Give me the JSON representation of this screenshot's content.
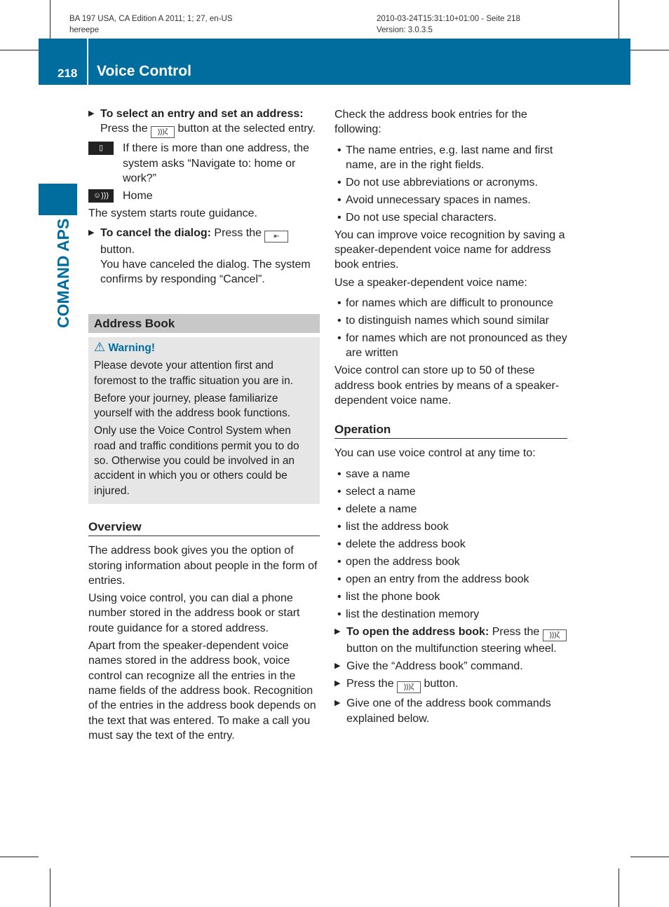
{
  "meta": {
    "left1": "BA 197 USA, CA Edition A 2011; 1; 27, en-US",
    "left2": "hereepe",
    "right1": "2010-03-24T15:31:10+01:00 - Seite 218",
    "right2": "Version: 3.0.3.5"
  },
  "header": {
    "page_number": "218",
    "title": "Voice Control",
    "side_tab": "COMAND APS",
    "accent": "#006d9f"
  },
  "left": {
    "step1_bold": "To select an entry and set an address:",
    "step1_a": "Press the",
    "step1_b": "button at the selected entry.",
    "display_text": "If there is more than one address, the system asks “Navigate to: home or work?”",
    "speak_text": "Home",
    "route": "The system starts route guidance.",
    "step2_bold": "To cancel the dialog:",
    "step2_a": "Press the",
    "step2_b": "button.",
    "step2_c": "You have canceled the dialog. The system confirms by responding “Cancel”.",
    "section": "Address Book",
    "warning_title": "Warning!",
    "warning": [
      "Please devote your attention first and foremost to the traffic situation you are in.",
      "Before your journey, please familiarize yourself with the address book functions.",
      "Only use the Voice Control System when road and traffic conditions permit you to do so. Otherwise you could be involved in an accident in which you or others could be injured."
    ],
    "overview_title": "Overview",
    "overview": [
      "The address book gives you the option of storing information about people in the form of entries.",
      "Using voice control, you can dial a phone number stored in the address book or start route guidance for a stored address.",
      "Apart from the speaker-dependent voice names stored in the address book, voice control can recognize all the entries in the name fields of the address book. Recognition of the entries in the address book depends on the text that was entered. To make a call you must say the text of the entry."
    ]
  },
  "right": {
    "check": "Check the address book entries for the following:",
    "check_items": [
      "The name entries, e.g. last name and first name, are in the right fields.",
      "Do not use abbreviations or acronyms.",
      "Avoid unnecessary spaces in names.",
      "Do not use special characters."
    ],
    "improve": "You can improve voice recognition by saving a speaker-dependent voice name for address book entries.",
    "use": "Use a speaker-dependent voice name:",
    "use_items": [
      "for names which are difficult to pronounce",
      "to distinguish names which sound similar",
      "for names which are not pronounced as they are written"
    ],
    "store": "Voice control can store up to 50 of these address book entries by means of a speaker-dependent voice name.",
    "operation_title": "Operation",
    "op_intro": "You can use voice control at any time to:",
    "op_items": [
      "save a name",
      "select a name",
      "delete a name",
      "list the address book",
      "delete the address book",
      "open the address book",
      "open an entry from the address book",
      "list the phone book",
      "list the destination memory"
    ],
    "s1_bold": "To open the address book:",
    "s1_a": "Press the",
    "s1_b": "button on the multifunction steering wheel.",
    "s2": "Give the “Address book” command.",
    "s3_a": "Press the",
    "s3_b": "button.",
    "s4": "Give one of the address book commands explained below."
  },
  "icons": {
    "talk": "talk-button-icon",
    "back": "back-button-icon",
    "display": "display-icon",
    "speak": "voice-output-icon",
    "warning": "warning-triangle-icon"
  }
}
